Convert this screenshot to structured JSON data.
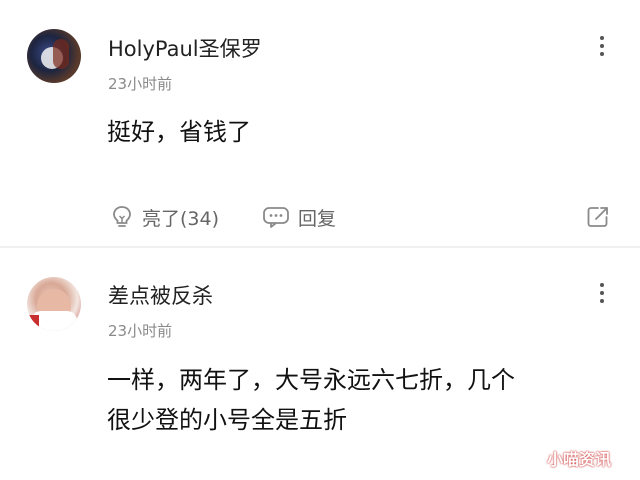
{
  "comments": [
    {
      "username": "HolyPaul圣保罗",
      "time": "23小时前",
      "content": "挺好，省钱了",
      "like_label": "亮了(34)",
      "reply_label": "回复"
    },
    {
      "username": "差点被反杀",
      "time": "23小时前",
      "content_line1": "一样，两年了，大号永远六七折，几个",
      "content_line2": "很少登的小号全是五折"
    }
  ],
  "icons": {
    "more": "more-vertical-icon",
    "like": "lightbulb-icon",
    "reply": "chat-bubble-icon",
    "share": "share-icon"
  },
  "watermark": "小喵资讯"
}
